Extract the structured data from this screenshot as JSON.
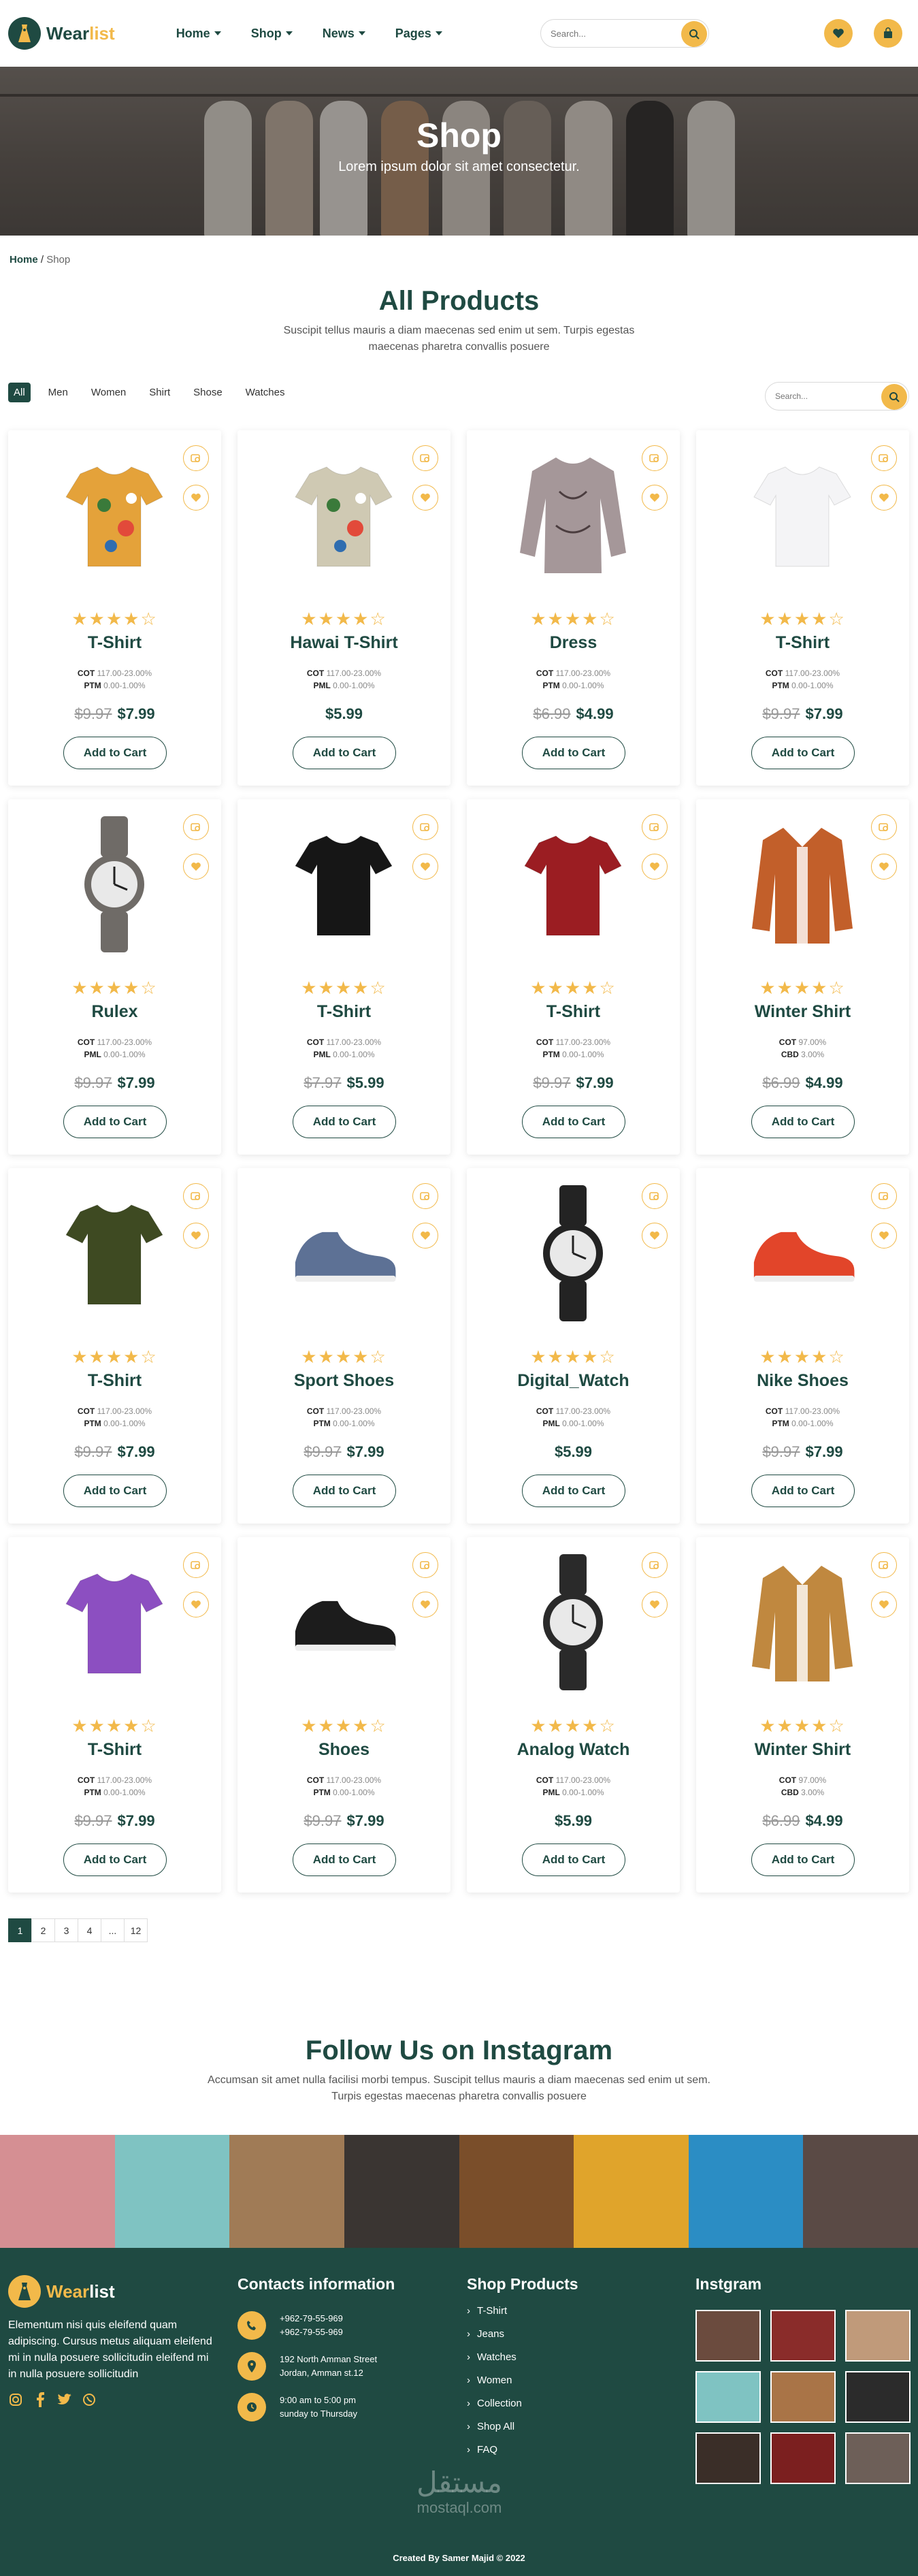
{
  "header": {
    "logo_text_main": "Wear",
    "logo_text_accent": "list",
    "nav": [
      "Home",
      "Shop",
      "News",
      "Pages"
    ],
    "search_placeholder": "Search..."
  },
  "hero": {
    "title": "Shop",
    "subtitle": "Lorem ipsum dolor sit amet consectetur."
  },
  "breadcrumb": {
    "home": "Home",
    "separator": "/",
    "current": "Shop"
  },
  "products_section": {
    "title": "All Products",
    "subtitle_line1": "Suscipit tellus mauris a diam maecenas sed enim ut sem. Turpis egestas",
    "subtitle_line2": "maecenas pharetra convallis posuere",
    "filters": [
      "All",
      "Men",
      "Women",
      "Shirt",
      "Shose",
      "Watches"
    ],
    "active_filter": "All",
    "search_placeholder": "Search..."
  },
  "products": [
    {
      "name": "T-Shirt",
      "spec1_label": "COT",
      "spec1_value": "117.00-23.00%",
      "spec2_label": "PTM",
      "spec2_value": "0.00-1.00%",
      "old_price": "$9.97",
      "price": "$7.99",
      "cta": "Add to Cart",
      "icon": "floral-shirt",
      "color": "#e4a23a"
    },
    {
      "name": "Hawai T-Shirt",
      "spec1_label": "COT",
      "spec1_value": "117.00-23.00%",
      "spec2_label": "PML",
      "spec2_value": "0.00-1.00%",
      "old_price": "",
      "price": "$5.99",
      "cta": "Add to Cart",
      "icon": "floral-shirt",
      "color": "#cfc9b3"
    },
    {
      "name": "Dress",
      "spec1_label": "COT",
      "spec1_value": "117.00-23.00%",
      "spec2_label": "PTM",
      "spec2_value": "0.00-1.00%",
      "old_price": "$6.99",
      "price": "$4.99",
      "cta": "Add to Cart",
      "icon": "blouse",
      "color": "#a59799"
    },
    {
      "name": "T-Shirt",
      "spec1_label": "COT",
      "spec1_value": "117.00-23.00%",
      "spec2_label": "PTM",
      "spec2_value": "0.00-1.00%",
      "old_price": "$9.97",
      "price": "$7.99",
      "cta": "Add to Cart",
      "icon": "t-shirt",
      "color": "#f4f4f6"
    },
    {
      "name": "Rulex",
      "spec1_label": "COT",
      "spec1_value": "117.00-23.00%",
      "spec2_label": "PML",
      "spec2_value": "0.00-1.00%",
      "old_price": "$9.97",
      "price": "$7.99",
      "cta": "Add to Cart",
      "icon": "watch",
      "color": "#6f6b67"
    },
    {
      "name": "T-Shirt",
      "spec1_label": "COT",
      "spec1_value": "117.00-23.00%",
      "spec2_label": "PML",
      "spec2_value": "0.00-1.00%",
      "old_price": "$7.97",
      "price": "$5.99",
      "cta": "Add to Cart",
      "icon": "t-shirt",
      "color": "#161616"
    },
    {
      "name": "T-Shirt",
      "spec1_label": "COT",
      "spec1_value": "117.00-23.00%",
      "spec2_label": "PTM",
      "spec2_value": "0.00-1.00%",
      "old_price": "$9.97",
      "price": "$7.99",
      "cta": "Add to Cart",
      "icon": "t-shirt",
      "color": "#9b1d22"
    },
    {
      "name": "Winter Shirt",
      "spec1_label": "COT",
      "spec1_value": "97.00%",
      "spec2_label": "CBD",
      "spec2_value": "3.00%",
      "old_price": "$6.99",
      "price": "$4.99",
      "cta": "Add to Cart",
      "icon": "jacket",
      "color": "#c25f2a"
    },
    {
      "name": "T-Shirt",
      "spec1_label": "COT",
      "spec1_value": "117.00-23.00%",
      "spec2_label": "PTM",
      "spec2_value": "0.00-1.00%",
      "old_price": "$9.97",
      "price": "$7.99",
      "cta": "Add to Cart",
      "icon": "t-shirt",
      "color": "#3e4a22"
    },
    {
      "name": "Sport Shoes",
      "spec1_label": "COT",
      "spec1_value": "117.00-23.00%",
      "spec2_label": "PTM",
      "spec2_value": "0.00-1.00%",
      "old_price": "$9.97",
      "price": "$7.99",
      "cta": "Add to Cart",
      "icon": "shoe",
      "color": "#5d7195"
    },
    {
      "name": "Digital_Watch",
      "spec1_label": "COT",
      "spec1_value": "117.00-23.00%",
      "spec2_label": "PML",
      "spec2_value": "0.00-1.00%",
      "old_price": "",
      "price": "$5.99",
      "cta": "Add to Cart",
      "icon": "watch",
      "color": "#232323"
    },
    {
      "name": "Nike Shoes",
      "spec1_label": "COT",
      "spec1_value": "117.00-23.00%",
      "spec2_label": "PTM",
      "spec2_value": "0.00-1.00%",
      "old_price": "$9.97",
      "price": "$7.99",
      "cta": "Add to Cart",
      "icon": "shoe",
      "color": "#e2452a"
    },
    {
      "name": "T-Shirt",
      "spec1_label": "COT",
      "spec1_value": "117.00-23.00%",
      "spec2_label": "PTM",
      "spec2_value": "0.00-1.00%",
      "old_price": "$9.97",
      "price": "$7.99",
      "cta": "Add to Cart",
      "icon": "t-shirt",
      "color": "#8c4fc1"
    },
    {
      "name": "Shoes",
      "spec1_label": "COT",
      "spec1_value": "117.00-23.00%",
      "spec2_label": "PTM",
      "spec2_value": "0.00-1.00%",
      "old_price": "$9.97",
      "price": "$7.99",
      "cta": "Add to Cart",
      "icon": "shoe",
      "color": "#1c1c1c"
    },
    {
      "name": "Analog Watch",
      "spec1_label": "COT",
      "spec1_value": "117.00-23.00%",
      "spec2_label": "PML",
      "spec2_value": "0.00-1.00%",
      "old_price": "",
      "price": "$5.99",
      "cta": "Add to Cart",
      "icon": "watch",
      "color": "#2a2a2a"
    },
    {
      "name": "Winter Shirt",
      "spec1_label": "COT",
      "spec1_value": "97.00%",
      "spec2_label": "CBD",
      "spec2_value": "3.00%",
      "old_price": "$6.99",
      "price": "$4.99",
      "cta": "Add to Cart",
      "icon": "jacket",
      "color": "#c0883f"
    }
  ],
  "pagination": {
    "pages": [
      "1",
      "2",
      "3",
      "4",
      "...",
      "12"
    ],
    "active": "1"
  },
  "instagram_section": {
    "title": "Follow Us on Instagram",
    "subtitle_line1": "Accumsan sit amet nulla facilisi morbi tempus. Suscipit tellus mauris a diam maecenas sed enim ut sem.",
    "subtitle_line2": "Turpis egestas maecenas pharetra convallis posuere",
    "strip_colors": [
      "#d58f93",
      "#7fc3c2",
      "#a07b56",
      "#3a3532",
      "#7a4e2a",
      "#e0a42b",
      "#2b8dc4",
      "#5a4a45"
    ]
  },
  "footer": {
    "logo_text_main": "Wear",
    "logo_text_accent": "list",
    "description": "Elementum nisi quis eleifend quam adipiscing. Cursus metus aliquam eleifend mi in nulla posuere sollicitudin eleifend mi in nulla posuere sollicitudin",
    "contacts_title": "Contacts information",
    "phone1": "+962-79-55-969",
    "phone2": "+962-79-55-969",
    "address1": "192 North Amman Street",
    "address2": "Jordan, Amman st.12",
    "hours1": "9:00 am to 5:00 pm",
    "hours2": "sunday to Thursday",
    "shop_title": "Shop Products",
    "shop_links": [
      "T-Shirt",
      "Jeans",
      "Watches",
      "Women",
      "Collection",
      "Shop All",
      "FAQ"
    ],
    "insta_title": "Instgram",
    "insta_colors": [
      "#6b4b3e",
      "#8a2c2a",
      "#c09a7a",
      "#7fc3c2",
      "#a97447",
      "#2b2b2b",
      "#3a2e28",
      "#7b1f1f",
      "#6d5f58"
    ],
    "credit": "Created By Samer Majid © 2022",
    "watermark_arabic": "مستقل",
    "watermark_latin": "mostaql.com"
  }
}
